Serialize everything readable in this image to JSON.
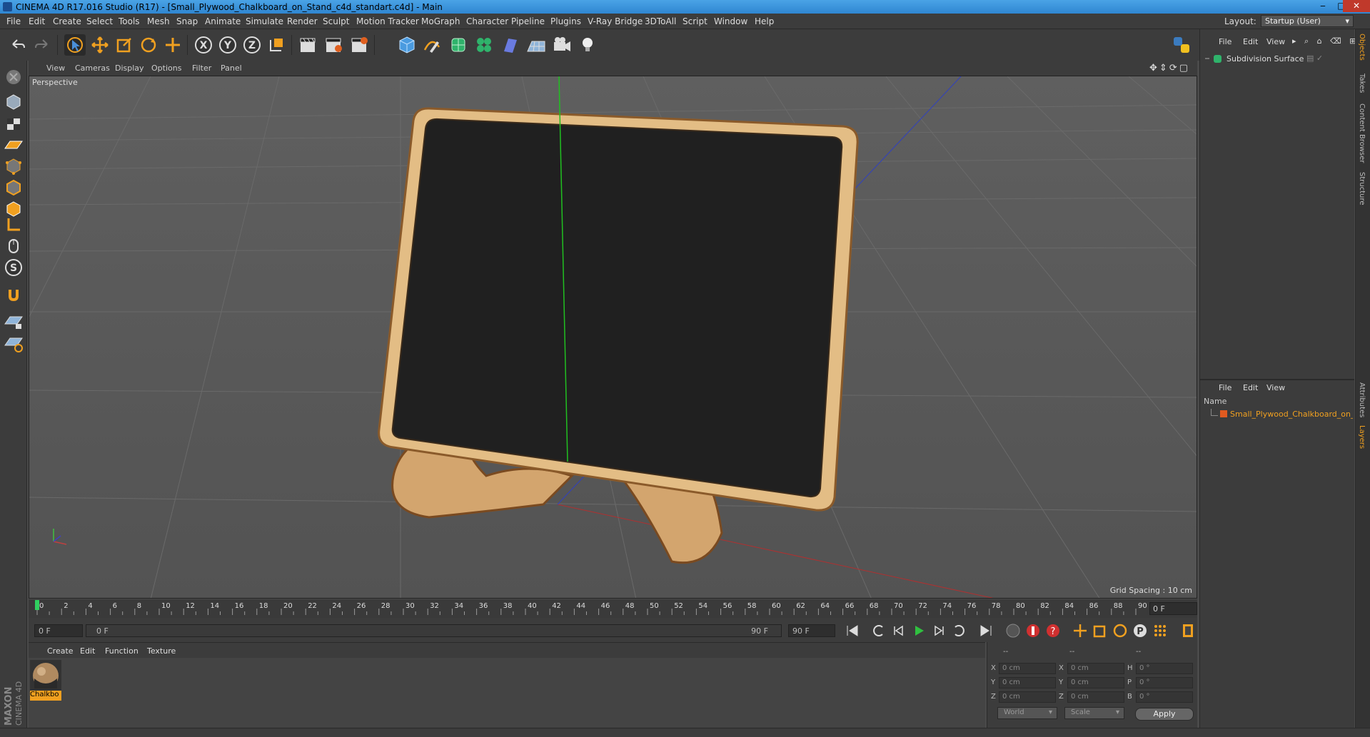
{
  "window": {
    "title": "CINEMA 4D R17.016 Studio (R17) - [Small_Plywood_Chalkboard_on_Stand_c4d_standart.c4d] - Main",
    "minimize": "‒",
    "maximize": "□",
    "close": "✕"
  },
  "menubar": {
    "items": [
      "File",
      "Edit",
      "Create",
      "Select",
      "Tools",
      "Mesh",
      "Snap",
      "Animate",
      "Simulate",
      "Render",
      "Sculpt",
      "Motion Tracker",
      "MoGraph",
      "Character",
      "Pipeline",
      "Plugins",
      "V-Ray Bridge",
      "3DToAll",
      "Script",
      "Window",
      "Help"
    ],
    "layout_label": "Layout:",
    "layout_value": "Startup (User)"
  },
  "viewport": {
    "menu": [
      "View",
      "Cameras",
      "Display",
      "Options",
      "Filter",
      "Panel"
    ],
    "label": "Perspective",
    "grid_spacing": "Grid Spacing : 10 cm"
  },
  "timeline": {
    "ticks": [
      "0",
      "2",
      "4",
      "6",
      "8",
      "10",
      "12",
      "14",
      "16",
      "18",
      "20",
      "22",
      "24",
      "26",
      "28",
      "30",
      "32",
      "34",
      "36",
      "38",
      "40",
      "42",
      "44",
      "46",
      "48",
      "50",
      "52",
      "54",
      "56",
      "58",
      "60",
      "62",
      "64",
      "66",
      "68",
      "70",
      "72",
      "74",
      "76",
      "78",
      "80",
      "82",
      "84",
      "86",
      "88",
      "90"
    ],
    "current_frame": "0 F",
    "start_field": "0 F",
    "range_start": "0 F",
    "range_end": "90 F",
    "end_field": "90 F"
  },
  "material_manager": {
    "menu": [
      "Create",
      "Edit",
      "Function",
      "Texture"
    ],
    "material_name": "Chalkbo"
  },
  "coordinates": {
    "header": [
      "--",
      "--",
      "--"
    ],
    "rows": [
      {
        "axis": "X",
        "pos": "0 cm",
        "axis2": "X",
        "size": "0 cm",
        "rot_label": "H",
        "rot": "0 °"
      },
      {
        "axis": "Y",
        "pos": "0 cm",
        "axis2": "Y",
        "size": "0 cm",
        "rot_label": "P",
        "rot": "0 °"
      },
      {
        "axis": "Z",
        "pos": "0 cm",
        "axis2": "Z",
        "size": "0 cm",
        "rot_label": "B",
        "rot": "0 °"
      }
    ],
    "mode_world": "World",
    "mode_scale": "Scale",
    "apply": "Apply"
  },
  "objects_panel": {
    "menu": [
      "File",
      "Edit",
      "View"
    ],
    "object_name": "Subdivision Surface"
  },
  "layers_panel": {
    "menu": [
      "File",
      "Edit",
      "View"
    ],
    "column_name": "Name",
    "layer_name": "Small_Plywood_Chalkboard_on_St"
  },
  "vertical_tabs": [
    "Objects",
    "Takes",
    "Content Browser",
    "Structure",
    "Attributes",
    "Layers"
  ],
  "brand": "MAXON CINEMA 4D",
  "colors": {
    "accent": "#f0a020",
    "viewport_bg": "#5a5a5a",
    "panel_bg": "#3c3c3c",
    "wood": "#d9b07a",
    "chalkboard": "#1e1e1e"
  }
}
